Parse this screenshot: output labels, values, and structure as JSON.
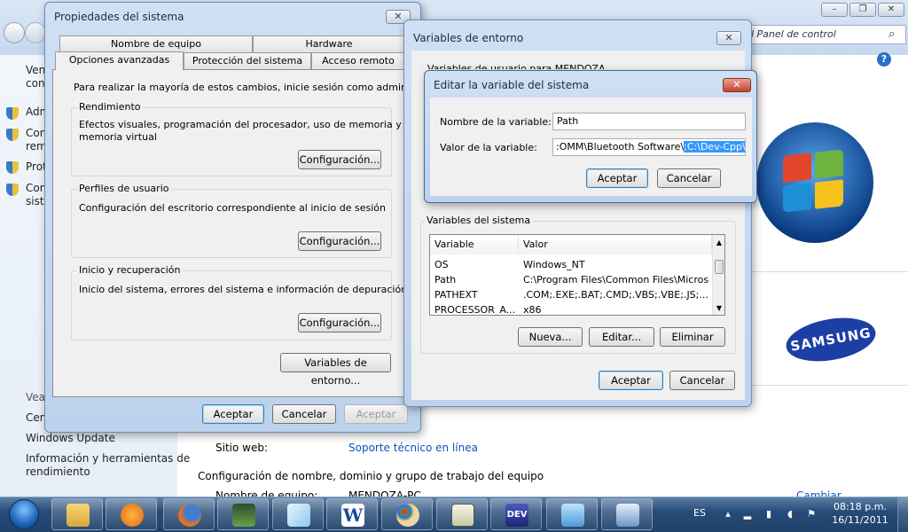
{
  "control_panel": {
    "address_text": "l Panel de control",
    "sidebar_items": [
      "Vent",
      "cont",
      "Adm",
      "Con",
      "rem",
      "Prot",
      "Con",
      "siste"
    ],
    "see_also": "Vea",
    "center_item": "Cen",
    "windows_update": "Windows Update",
    "perf_info_line1": "Información y herramientas de",
    "perf_info_line2": "rendimiento",
    "website_label": "Sitio web:",
    "website_link": "Soporte técnico en línea",
    "config_heading": "Configuración de nombre, dominio y grupo de trabajo del equipo",
    "bottom_partial": "Nombre de equipo:",
    "bottom_value": "MENDOZA-PC",
    "change_partial": "Cambiar",
    "brand_logo": "SAMSUNG"
  },
  "system_props": {
    "title": "Propiedades del sistema",
    "tabs_row1": [
      "Nombre de equipo",
      "Hardware"
    ],
    "tabs_row2": [
      "Opciones avanzadas",
      "Protección del sistema",
      "Acceso remoto"
    ],
    "admin_note": "Para realizar la mayoría de estos cambios, inicie sesión como administrador.",
    "perf": {
      "title": "Rendimiento",
      "desc1": "Efectos visuales, programación del procesador, uso de memoria y",
      "desc2": "memoria virtual",
      "button": "Configuración..."
    },
    "profiles": {
      "title": "Perfiles de usuario",
      "desc": "Configuración del escritorio correspondiente al inicio de sesión",
      "button": "Configuración..."
    },
    "startup": {
      "title": "Inicio y recuperación",
      "desc": "Inicio del sistema, errores del sistema e información de depuración",
      "button": "Configuración..."
    },
    "env_button": "Variables de entorno...",
    "ok": "Aceptar",
    "cancel": "Cancelar",
    "apply": "Aceptar"
  },
  "env_vars": {
    "title": "Variables de entorno",
    "user_vars_partial": "Variables de usuario para MENDOZA",
    "system_vars_title": "Variables del sistema",
    "columns": [
      "Variable",
      "Valor"
    ],
    "rows": [
      {
        "name": "OS",
        "value": "Windows_NT"
      },
      {
        "name": "Path",
        "value": "C:\\Program Files\\Common Files\\Microsof..."
      },
      {
        "name": "PATHEXT",
        "value": ".COM;.EXE;.BAT;.CMD;.VBS;.VBE;.JS;...."
      },
      {
        "name": "PROCESSOR_A...",
        "value": "x86"
      }
    ],
    "new": "Nueva...",
    "edit": "Editar...",
    "delete": "Eliminar",
    "ok": "Aceptar",
    "cancel": "Cancelar"
  },
  "edit_var": {
    "title": "Editar la variable del sistema",
    "name_label": "Nombre de la variable:",
    "name_value": "Path",
    "value_label": "Valor de la variable:",
    "value_text": ":OMM\\Bluetooth Software\\",
    "value_selected": ";C:\\Dev-Cpp\\bin",
    "ok": "Aceptar",
    "cancel": "Cancelar"
  },
  "taskbar": {
    "apps": [
      "explorer-icon",
      "media-player-icon",
      "firefox-icon",
      "task-manager-icon",
      "notepad-icon",
      "word-icon",
      "paint-icon",
      "plot-app-icon",
      "dev-cpp-icon",
      "control-panel-icon",
      "system-icon"
    ],
    "dev_label": "DEV",
    "word_label": "W",
    "language": "ES",
    "time": "08:18 p.m.",
    "date": "16/11/2011"
  }
}
